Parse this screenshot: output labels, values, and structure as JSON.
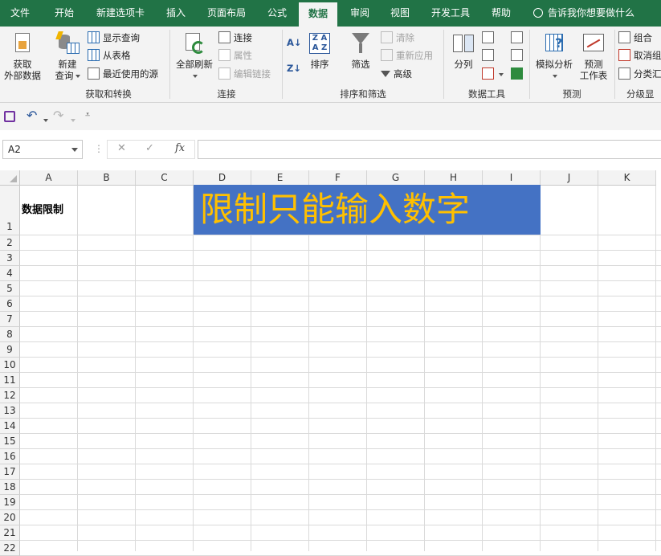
{
  "tabs": [
    "文件",
    "开始",
    "新建选项卡",
    "插入",
    "页面布局",
    "公式",
    "数据",
    "审阅",
    "视图",
    "开发工具",
    "帮助"
  ],
  "active_tab": "数据",
  "tell_me": "告诉我你想要做什么",
  "ribbon": {
    "get_external": [
      "获取",
      "外部数据"
    ],
    "new_query": [
      "新建",
      "查询"
    ],
    "show_queries": "显示查询",
    "from_table": "从表格",
    "recent_sources": "最近使用的源",
    "group_get_transform": "获取和转换",
    "refresh_all": "全部刷新",
    "connections": "连接",
    "properties": "属性",
    "edit_links": "编辑链接",
    "group_connections": "连接",
    "sort": "排序",
    "filter": "筛选",
    "clear": "清除",
    "reapply": "重新应用",
    "advanced": "高级",
    "group_sort_filter": "排序和筛选",
    "text_to_columns": "分列",
    "group_data_tools": "数据工具",
    "what_if": "模拟分析",
    "forecast_sheet": [
      "预测",
      "工作表"
    ],
    "group_forecast": "预测",
    "group": "组合",
    "ungroup": "取消组",
    "subtotal": "分类汇",
    "group_outline": "分级显"
  },
  "name_box": "A2",
  "formula_icons": [
    "✕",
    "✓",
    "fx"
  ],
  "columns": [
    "A",
    "B",
    "C",
    "D",
    "E",
    "F",
    "G",
    "H",
    "I",
    "J",
    "K"
  ],
  "rows": [
    "1",
    "2",
    "3",
    "4",
    "5",
    "6",
    "7",
    "8",
    "9",
    "10",
    "11",
    "12",
    "13",
    "14",
    "15",
    "16",
    "17",
    "18",
    "19",
    "20",
    "21",
    "22"
  ],
  "cells": {
    "A1": "数据限制",
    "D1": "限制只能输入数字"
  },
  "colors": {
    "tab_bar": "#217346",
    "banner_fill": "#4472c4",
    "banner_text": "#ffc000"
  }
}
